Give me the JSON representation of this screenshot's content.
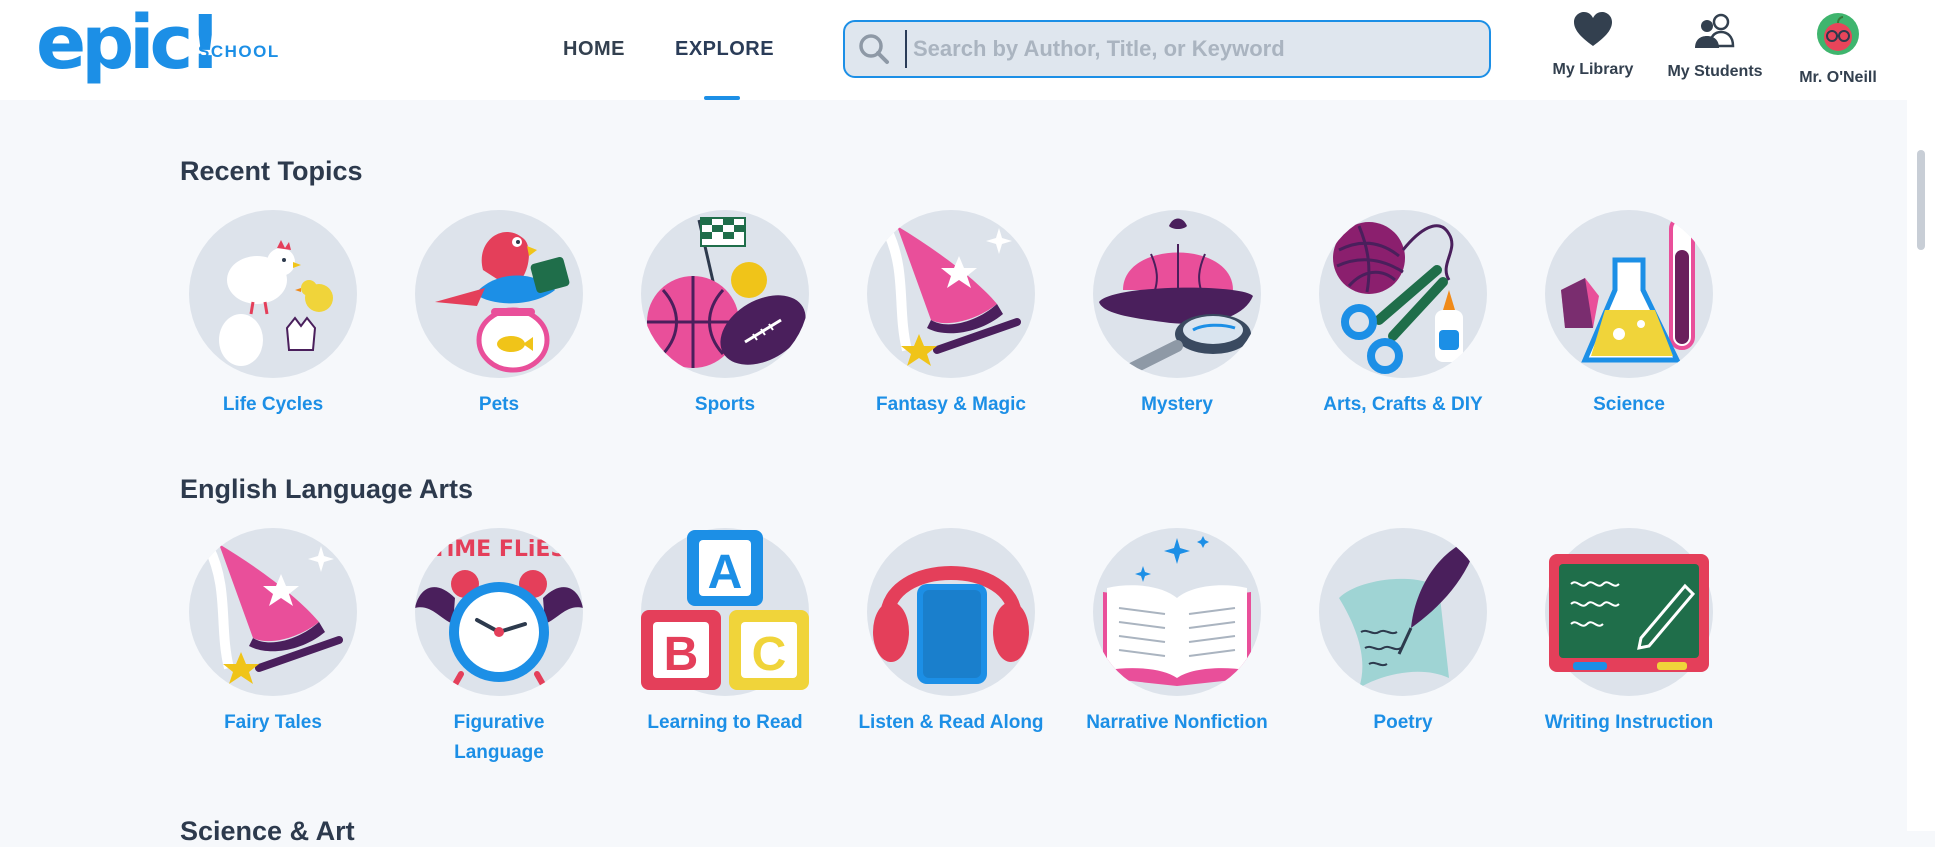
{
  "brand": {
    "logo": "epic!",
    "product": "SCHOOL"
  },
  "nav": {
    "home": "HOME",
    "explore": "EXPLORE"
  },
  "search": {
    "placeholder": "Search by Author, Title, or Keyword",
    "value": ""
  },
  "user_menu": {
    "library": "My Library",
    "students": "My Students",
    "profile": "Mr. O'Neill"
  },
  "sections": [
    {
      "title": "Recent Topics",
      "topics": [
        {
          "label": "Life Cycles",
          "icon": "chicken-egg-icon"
        },
        {
          "label": "Pets",
          "icon": "parrot-fishbowl-icon"
        },
        {
          "label": "Sports",
          "icon": "balls-flag-icon"
        },
        {
          "label": "Fantasy & Magic",
          "icon": "wizard-hat-icon"
        },
        {
          "label": "Mystery",
          "icon": "detective-hat-icon"
        },
        {
          "label": "Arts, Crafts & DIY",
          "icon": "yarn-scissors-icon"
        },
        {
          "label": "Science",
          "icon": "flask-icon"
        }
      ]
    },
    {
      "title": "English Language Arts",
      "topics": [
        {
          "label": "Fairy Tales",
          "icon": "wizard-hat-icon"
        },
        {
          "label": "Figurative\nLanguage",
          "icon": "alarm-clock-icon",
          "banner": "TiME FLiES"
        },
        {
          "label": "Learning to Read",
          "icon": "abc-blocks-icon",
          "letters": [
            "A",
            "B",
            "C"
          ]
        },
        {
          "label": "Listen & Read Along",
          "icon": "headphones-book-icon"
        },
        {
          "label": "Narrative Nonfiction",
          "icon": "open-book-icon"
        },
        {
          "label": "Poetry",
          "icon": "quill-scroll-icon"
        },
        {
          "label": "Writing Instruction",
          "icon": "chalkboard-icon"
        }
      ]
    }
  ],
  "next_section": {
    "title": "Science & Art"
  },
  "colors": {
    "accent": "#1c8fe6",
    "heading": "#2d3a4d",
    "tile_bg": "#dde3eb",
    "pink": "#e94f9a",
    "purple": "#4a1f5c"
  }
}
